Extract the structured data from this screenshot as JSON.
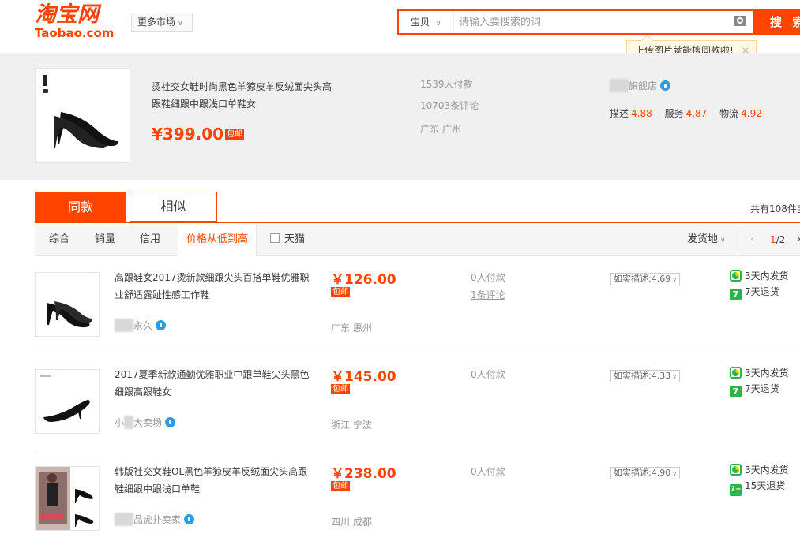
{
  "header": {
    "logo_cn": "淘宝网",
    "logo_en": "Taobao.com",
    "more_markets": "更多市场",
    "search_category": "宝贝",
    "search_placeholder": "请输入要搜索的词",
    "search_button": "搜 索",
    "tooltip": "上传图片就能搜同款啦!",
    "tooltip_close": "×"
  },
  "source_item": {
    "title": "烫社交女鞋时尚黑色羊猄皮羊反绒面尖头高跟鞋细跟中跟浅口单鞋女",
    "price": "¥399.00",
    "baoyou": "包邮",
    "sales": "1539人付款",
    "reviews": "10703条评论",
    "location": "广东 广州",
    "shop": "旗舰店",
    "ratings": [
      {
        "label": "描述",
        "value": "4.88"
      },
      {
        "label": "服务",
        "value": "4.87"
      },
      {
        "label": "物流",
        "value": "4.92"
      }
    ]
  },
  "tabs": {
    "same": "同款",
    "similar": "相似",
    "total": "共有108件宝"
  },
  "sort": {
    "items": [
      "综合",
      "销量",
      "信用",
      "价格从低到高"
    ],
    "tmall": "天猫",
    "origin": "发货地",
    "pager_current": "1",
    "pager_total": "/2"
  },
  "products": [
    {
      "title": "高跟鞋女2017烫新款细跟尖头百搭单鞋优雅职业舒适露趾性感工作鞋",
      "price": "￥126.00",
      "baoyou": "包邮",
      "shop": "永久",
      "location": "广东 惠州",
      "sales": "0人付款",
      "reviews": "1条评论",
      "rating": "如实描述:4.69",
      "ship": "3天内发货",
      "return": "7天退货",
      "return_icon": "7"
    },
    {
      "title": "2017夏季新款通勤优雅职业中跟单鞋尖头黑色细跟高跟鞋女",
      "price": "￥145.00",
      "baoyou": "包邮",
      "shop": "大卖场",
      "shop_prefix": "小",
      "location": "浙江 宁波",
      "sales": "0人付款",
      "reviews": "",
      "rating": "如实描述:4.33",
      "ship": "3天内发货",
      "return": "7天退货",
      "return_icon": "7"
    },
    {
      "title": "韩版社交女鞋OL黑色羊猄皮羊反绒面尖头高跟鞋细跟中跟浅口单鞋",
      "price": "￥238.00",
      "baoyou": "包邮",
      "shop": "品虎扑卖家",
      "location": "四川 成都",
      "sales": "0人付款",
      "reviews": "",
      "rating": "如实描述:4.90",
      "ship": "3天内发货",
      "return": "15天退货",
      "return_icon": "7+"
    }
  ],
  "colors": {
    "accent": "#ff4400",
    "service_green": "#2db34a",
    "ww_blue": "#2a9ce8"
  }
}
